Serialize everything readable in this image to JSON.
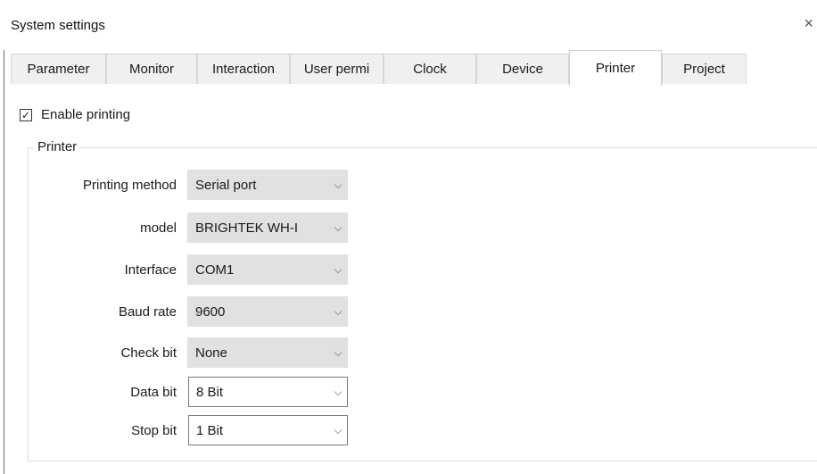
{
  "window": {
    "title": "System settings",
    "close_glyph": "×"
  },
  "tabs": [
    {
      "label": "Parameter",
      "active": false
    },
    {
      "label": "Monitor",
      "active": false
    },
    {
      "label": "Interaction",
      "active": false
    },
    {
      "label": "User permi",
      "active": false
    },
    {
      "label": "Clock",
      "active": false
    },
    {
      "label": "Device",
      "active": false
    },
    {
      "label": "Printer",
      "active": true
    },
    {
      "label": "Project",
      "active": false
    }
  ],
  "enable_printing": {
    "label": "Enable printing",
    "checked": true,
    "check_glyph": "✓"
  },
  "printer_group": {
    "legend": "Printer",
    "fields": [
      {
        "label": "Printing method",
        "value": "Serial port"
      },
      {
        "label": "model",
        "value": "BRIGHTEK  WH-I"
      },
      {
        "label": "Interface",
        "value": "COM1"
      },
      {
        "label": "Baud rate",
        "value": "9600"
      },
      {
        "label": "Check bit",
        "value": "None"
      },
      {
        "label": "Data bit",
        "value": "8 Bit"
      },
      {
        "label": "Stop bit",
        "value": "1 Bit"
      }
    ],
    "chevron_glyph": "⌵"
  }
}
